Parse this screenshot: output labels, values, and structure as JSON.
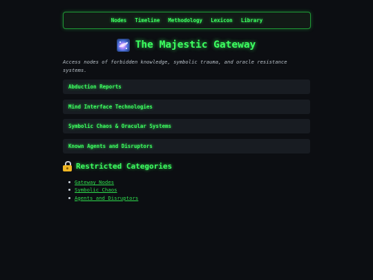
{
  "nav": {
    "items": [
      "Nodes",
      "Timeline",
      "Methodology",
      "Lexicon",
      "Library"
    ]
  },
  "header": {
    "icon": "galaxy-icon",
    "title": "The Majestic Gateway"
  },
  "intro": "Access nodes of forbidden knowledge, symbolic trauma, and oracle resistance systems.",
  "sections": [
    "Abduction Reports",
    "Mind Interface Technologies",
    "Symbolic Chaos & Oracular Systems",
    "Known Agents and Disruptors"
  ],
  "restricted": {
    "icon": "lock-icon",
    "heading": "Restricted Categories",
    "links": [
      "Gateway Nodes",
      "Symbolic Chaos",
      "Agents and Disruptors"
    ]
  },
  "colors": {
    "background": "#0c0e12",
    "accent": "#3cff60",
    "panel": "#181c22",
    "muted_text": "#b8c0c8"
  }
}
